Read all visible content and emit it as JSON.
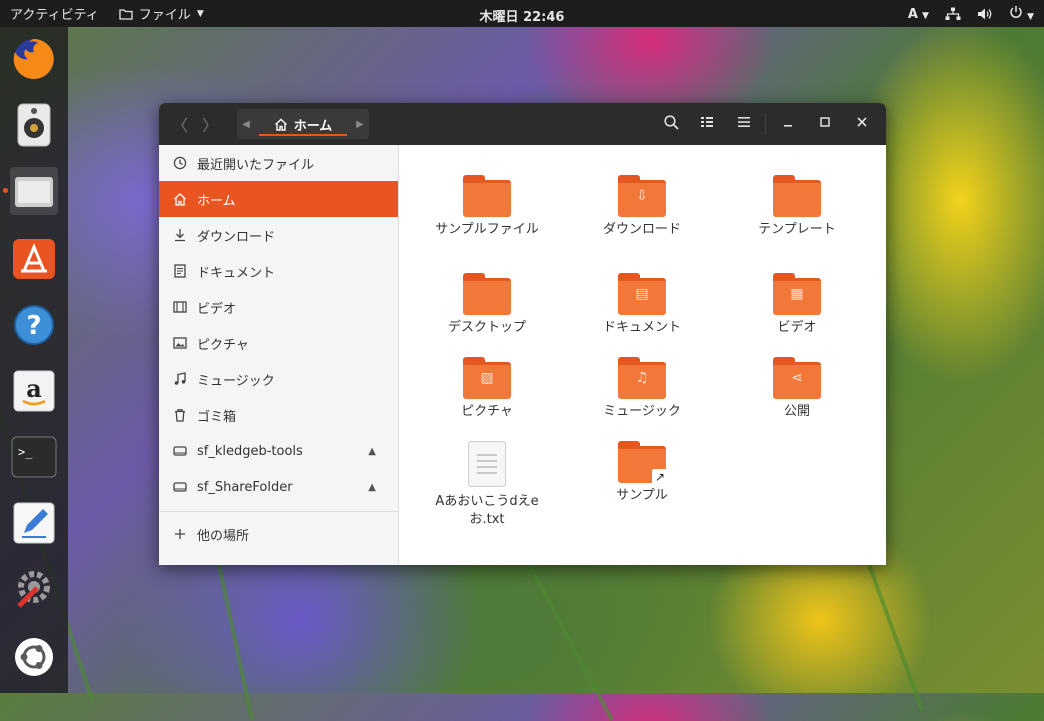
{
  "topbar": {
    "activities": "アクティビティ",
    "app_name": "ファイル",
    "clock": "木曜日 22:46",
    "input_method": "A"
  },
  "dock": {
    "items": [
      "firefox",
      "rhythmbox",
      "files",
      "ubuntu-software",
      "help",
      "amazon",
      "terminal",
      "text-editor",
      "settings",
      "show-applications"
    ]
  },
  "window": {
    "path_home_label": "ホーム"
  },
  "sidebar": {
    "items": [
      {
        "label": "最近開いたファイル",
        "icon": "clock-icon"
      },
      {
        "label": "ホーム",
        "icon": "home-icon",
        "active": true
      },
      {
        "label": "ダウンロード",
        "icon": "download-icon"
      },
      {
        "label": "ドキュメント",
        "icon": "document-icon"
      },
      {
        "label": "ビデオ",
        "icon": "video-icon"
      },
      {
        "label": "ピクチャ",
        "icon": "picture-icon"
      },
      {
        "label": "ミュージック",
        "icon": "music-icon"
      },
      {
        "label": "ゴミ箱",
        "icon": "trash-icon"
      },
      {
        "label": "sf_kledgeb-tools",
        "icon": "drive-icon"
      },
      {
        "label": "sf_ShareFolder",
        "icon": "drive-icon"
      }
    ],
    "other_locations": "他の場所"
  },
  "files": [
    {
      "label": "サンプルファイル",
      "emblem": ""
    },
    {
      "label": "ダウンロード",
      "emblem": "⇩"
    },
    {
      "label": "テンプレート",
      "emblem": ""
    },
    {
      "label": "デスクトップ",
      "emblem": ""
    },
    {
      "label": "ドキュメント",
      "emblem": "▤"
    },
    {
      "label": "ビデオ",
      "emblem": "▦"
    },
    {
      "label": "ピクチャ",
      "emblem": "▨"
    },
    {
      "label": "ミュージック",
      "emblem": "♫"
    },
    {
      "label": "公開",
      "emblem": "⋖"
    },
    {
      "label_line1": "Aあおいこうdえe",
      "label_line2": "お.txt"
    },
    {
      "label": "サンプル",
      "emblem": "↗"
    }
  ],
  "colors": {
    "accent": "#e95420",
    "folder": "#f2783a",
    "headerbar": "#2c2c2c"
  }
}
